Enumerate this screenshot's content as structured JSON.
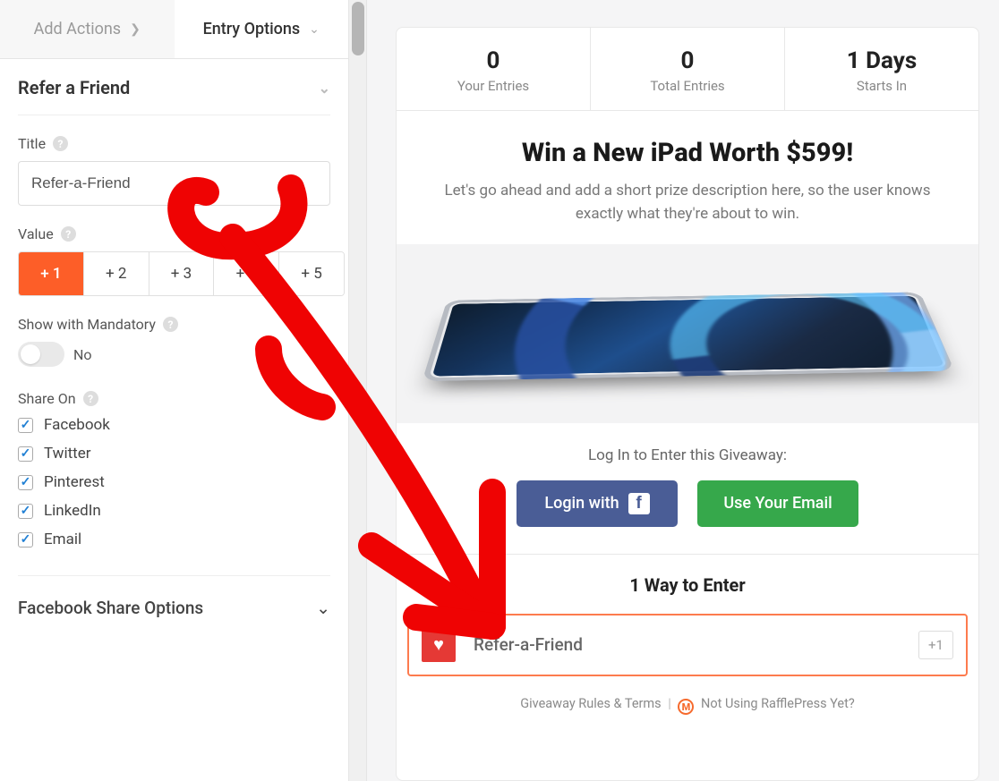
{
  "sidebar": {
    "tabs": {
      "add_actions": "Add Actions",
      "entry_options": "Entry Options"
    },
    "section_title": "Refer a Friend",
    "title_label": "Title",
    "title_value": "Refer-a-Friend",
    "value_label": "Value",
    "value_options": [
      "+ 1",
      "+ 2",
      "+ 3",
      "+ 4",
      "+ 5"
    ],
    "value_selected_index": 0,
    "mandatory_label": "Show with Mandatory",
    "mandatory_state": "No",
    "share_on_label": "Share On",
    "share_options": [
      {
        "label": "Facebook",
        "checked": true
      },
      {
        "label": "Twitter",
        "checked": true
      },
      {
        "label": "Pinterest",
        "checked": true
      },
      {
        "label": "LinkedIn",
        "checked": true
      },
      {
        "label": "Email",
        "checked": true
      }
    ],
    "fb_share_options_title": "Facebook Share Options"
  },
  "preview": {
    "stats": {
      "your_entries": {
        "value": "0",
        "label": "Your Entries"
      },
      "total_entries": {
        "value": "0",
        "label": "Total Entries"
      },
      "starts_in": {
        "value": "1 Days",
        "label": "Starts In"
      }
    },
    "headline": "Win a New iPad Worth $599!",
    "description": "Let's go ahead and add a short prize description here, so the user knows exactly what they're about to win.",
    "login_title": "Log In to Enter this Giveaway:",
    "login_fb": "Login with",
    "login_email": "Use Your Email",
    "ways_title": "1 Way to Enter",
    "entry": {
      "label": "Refer-a-Friend",
      "value": "+1"
    },
    "footer": {
      "rules": "Giveaway Rules & Terms",
      "cta": "Not Using RafflePress Yet?"
    }
  }
}
